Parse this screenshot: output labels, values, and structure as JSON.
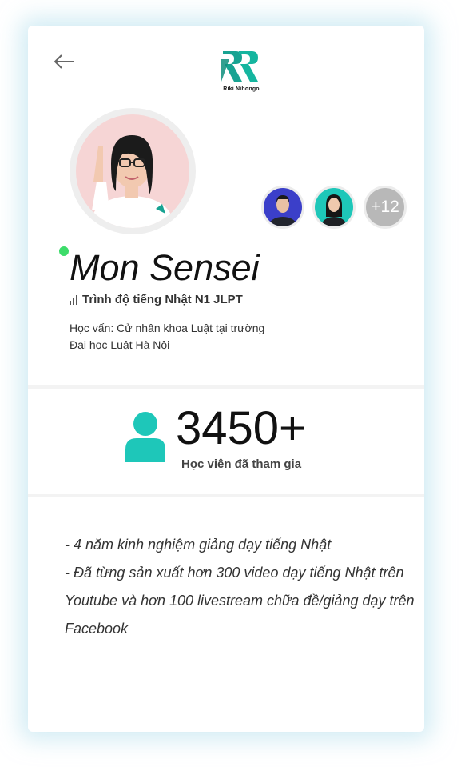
{
  "header": {
    "back_icon": "arrow-left-icon",
    "logo_text": "Riki Nihongo"
  },
  "profile": {
    "name": "Mon Sensei",
    "level": "Trình độ tiếng Nhật N1 JLPT",
    "education_line1": "Học vấn: Cử nhân khoa Luật tại trường",
    "education_line2": "Đại học Luật Hà Nội",
    "online_color": "#3ddc6a"
  },
  "other_teachers": {
    "more_count": "+12"
  },
  "stats": {
    "count": "3450+",
    "label": "Học viên đã tham gia",
    "icon": "user-icon",
    "accent": "#1ec7b9"
  },
  "bullets": [
    "- 4 năm kinh nghiệm giảng dạy tiếng Nhật",
    "- Đã từng sản xuất hơn 300 video dạy tiếng Nhật trên Youtube và hơn 100 livestream chữa đề/giảng dạy trên Facebook"
  ]
}
